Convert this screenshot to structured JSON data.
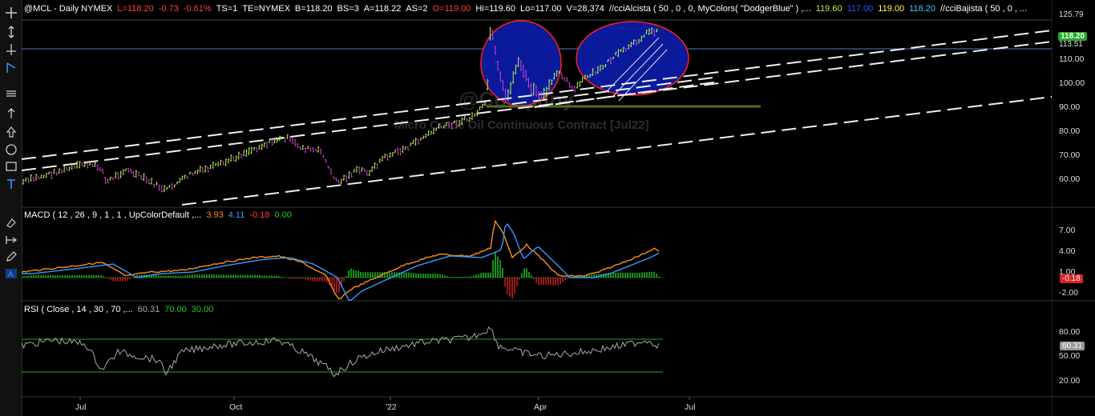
{
  "header": {
    "symbol": "@MCL - Daily  NYMEX",
    "last": "L=118.20",
    "chg": "-0.73",
    "chg_pct": "-0.61%",
    "ts": "TS=1",
    "exch": "TE=NYMEX",
    "bid": "B=118.20",
    "bs": "BS=3",
    "ask": "A=118.22",
    "as": "AS=2",
    "open": "O=119.00",
    "high": "Hi=119.60",
    "low": "Lo=117.00",
    "vol": "V=28,374",
    "ind1": "//cciAlcista ( 50 , 0 , 0, MyColors( \"DodgerBlue\" ) ,...",
    "ind1_v1": "119.60",
    "ind1_v2": "117.00",
    "ind1_v3": "119.00",
    "ind1_v4": "118.20",
    "ind2": "//cciBajista ( 50 , 0 , ..."
  },
  "watermark": {
    "line1": "@Company",
    "line2": "Micro Crude Oil Continuous Contract [Jul22]"
  },
  "macd": {
    "label": "MACD ( 12 , 26 , 9 , 1 , 1 , UpColorDefault ,...",
    "v1": "3.93",
    "v2": "4.11",
    "v3": "-0.18",
    "v4": "0.00",
    "tag": "-0.18",
    "axis": [
      "7.00",
      "4.00",
      "1.00",
      "-2.00"
    ]
  },
  "rsi": {
    "label": "RSI ( Close , 14 , 30 , 70 ,...",
    "v1": "60.31",
    "v2": "70.00",
    "v3": "30.00",
    "tag": "60.31",
    "axis": [
      "80.00",
      "50.00",
      "20.00"
    ]
  },
  "price_axis": {
    "ticks": [
      "110.00",
      "100.00",
      "90.00",
      "80.00",
      "70.00",
      "60.00"
    ],
    "tag_last": "118.20",
    "tag_top": "125.79",
    "tag_line": "113.51"
  },
  "dates": [
    "Jul",
    "Oct",
    "'22",
    "Apr",
    "Jul"
  ],
  "colors": {
    "up": "#b8f050",
    "down": "#d040d0",
    "macd_line": "#ff8c1a",
    "signal_line": "#3399ff",
    "hist_up": "#22cc22",
    "hist_down": "#dd2222",
    "ellipse_fill": "#0a1a9a",
    "ellipse_stroke": "#ff2020",
    "rsi_line": "#aaaaaa",
    "rsi_over": "#ff2020",
    "rsi_under": "#3399ff",
    "level_line": "#22aa22"
  },
  "toolbar_icons": [
    "crosshair-icon",
    "cursor-vertical-icon",
    "cursor-horizontal-icon",
    "trendline-icon",
    "trendline-alt-icon",
    "horizontal-lines-icon",
    "arrow-up-icon",
    "arrow-up-outline-icon",
    "circle-icon",
    "rectangle-icon",
    "text-icon",
    "paint-icon",
    "arrows-icon",
    "pencil-icon",
    "text-box-icon"
  ]
}
